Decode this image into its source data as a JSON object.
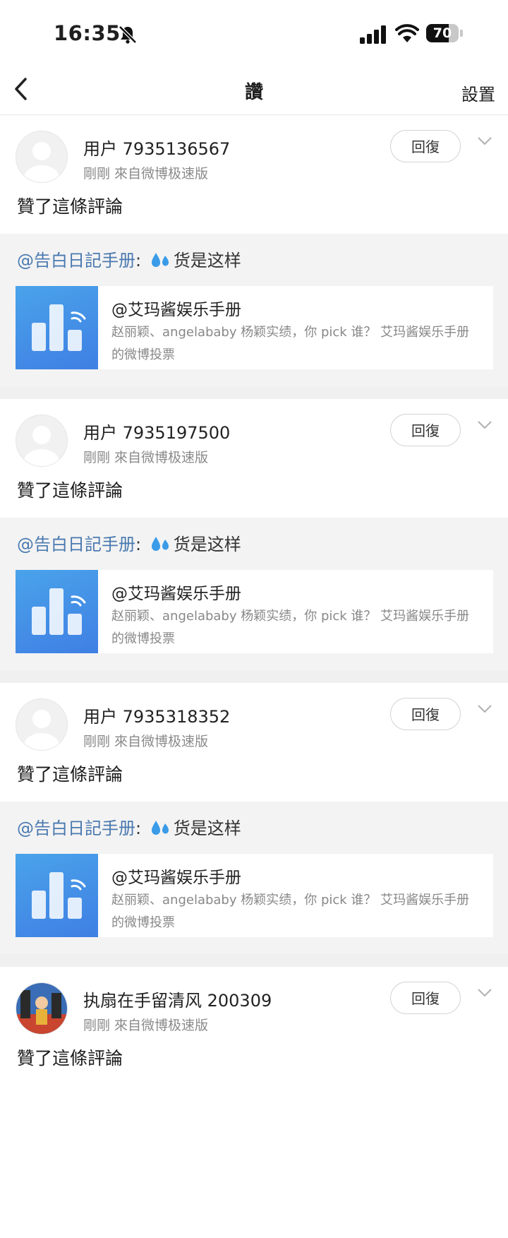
{
  "status_bar": {
    "time": "16:35",
    "battery": "70",
    "battery_level": 0.7
  },
  "nav": {
    "title": "讚",
    "settings_label": "設置"
  },
  "items": [
    {
      "username": "用户 7935136567",
      "meta": "剛剛  來自微博极速版",
      "reply_label": "回復",
      "action": "贊了這條評論",
      "quote_mention": "@告白日記手册",
      "quote_sep": ": ",
      "quote_text": "货是这样",
      "embed_title": "@艾玛酱娱乐手册",
      "embed_desc": "赵丽颖、angelababy 杨颖实绩，你 pick 谁？  艾玛酱娱乐手册的微博投票"
    },
    {
      "username": "用户 7935197500",
      "meta": "剛剛  來自微博极速版",
      "reply_label": "回復",
      "action": "贊了這條評論",
      "quote_mention": "@告白日記手册",
      "quote_sep": ": ",
      "quote_text": "货是这样",
      "embed_title": "@艾玛酱娱乐手册",
      "embed_desc": "赵丽颖、angelababy 杨颖实绩，你 pick 谁？  艾玛酱娱乐手册的微博投票"
    },
    {
      "username": "用户 7935318352",
      "meta": "剛剛  來自微博极速版",
      "reply_label": "回復",
      "action": "贊了這條評論",
      "quote_mention": "@告白日記手册",
      "quote_sep": ": ",
      "quote_text": "货是这样",
      "embed_title": "@艾玛酱娱乐手册",
      "embed_desc": "赵丽颖、angelababy 杨颖实绩，你 pick 谁？  艾玛酱娱乐手册的微博投票"
    },
    {
      "username": "执扇在手留清风 200309",
      "meta": "剛剛  來自微博极速版",
      "reply_label": "回復",
      "action": "贊了這條評論"
    }
  ]
}
